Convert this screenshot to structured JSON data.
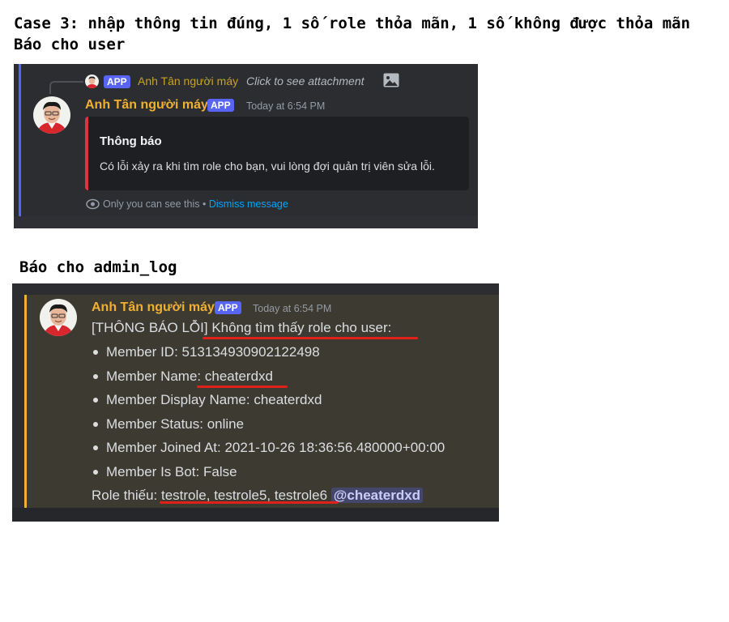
{
  "headings": {
    "case": "Case 3: nhập thông tin đúng, 1 số role thỏa mãn, 1 số không được thỏa mãn",
    "user_report": "Báo cho user",
    "admin_report": "Báo cho admin_log"
  },
  "user_panel": {
    "reply": {
      "bot_name": "Anh Tân người máy",
      "badge": "APP",
      "text": "Click to see attachment",
      "icon": "image-icon"
    },
    "message": {
      "author": "Anh Tân người máy",
      "badge": "APP",
      "timestamp": "Today at 6:54 PM",
      "embed_title": "Thông báo",
      "embed_description": "Có lỗi xảy ra khi tìm role cho bạn, vui lòng đợi quản trị viên sửa lỗi.",
      "ephemeral_notice": "Only you can see this",
      "separator": " • ",
      "dismiss_label": "Dismiss message"
    }
  },
  "admin_panel": {
    "author": "Anh Tân người máy",
    "badge": "APP",
    "timestamp": "Today at 6:54 PM",
    "line1_prefix": "[THÔNG BÁO LỖI] ",
    "line1_main": "Không tìm thấy role cho user:",
    "bullets": [
      "Member ID: 513134930902122498",
      "Member Name: cheaterdxd",
      "Member Display Name: cheaterdxd",
      "Member Status: online",
      "Member Joined At: 2021-10-26 18:36:56.480000+00:00",
      "Member Is Bot: False"
    ],
    "role_missing_label": "Role thiếu: ",
    "role_missing_values": "testrole, testrole5, testrole6",
    "mention": "@cheaterdxd"
  },
  "colors": {
    "bot_name": "#f0b132",
    "app_badge": "#5865f2",
    "link": "#00a8fc",
    "annotation_underline": "#e0201a",
    "embed_border": "#da373c"
  }
}
